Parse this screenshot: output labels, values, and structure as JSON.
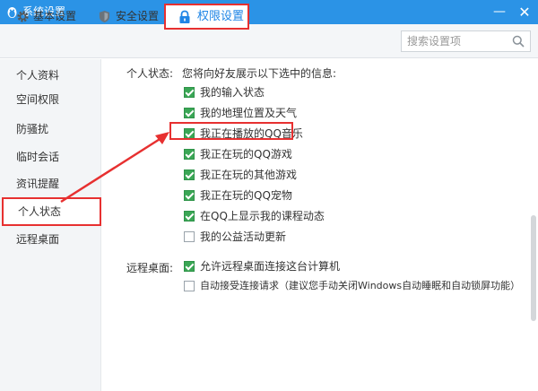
{
  "window": {
    "title": "系统设置",
    "minimize_glyph": "—",
    "close_glyph": "✕",
    "logo_icon": "qq-penguin-icon"
  },
  "toolbar": {
    "tabs": [
      {
        "label": "基本设置",
        "icon": "gear-icon"
      },
      {
        "label": "安全设置",
        "icon": "shield-icon"
      },
      {
        "label": "权限设置",
        "icon": "lock-icon",
        "active": true
      }
    ]
  },
  "search": {
    "placeholder": "搜索设置项",
    "icon": "search-icon"
  },
  "sidebar": {
    "items": [
      {
        "label": "个人资料"
      },
      {
        "label": "空间权限"
      },
      {
        "label": "防骚扰"
      },
      {
        "label": "临时会话"
      },
      {
        "label": "资讯提醒"
      },
      {
        "label": "个人状态",
        "active": true
      },
      {
        "label": "远程桌面"
      }
    ]
  },
  "personal_status": {
    "label": "个人状态:",
    "intro": "您将向好友展示以下选中的信息:",
    "options": [
      {
        "label": "我的输入状态",
        "checked": true
      },
      {
        "label": "我的地理位置及天气",
        "checked": true
      },
      {
        "label": "我正在播放的QQ音乐",
        "checked": true
      },
      {
        "label": "我正在玩的QQ游戏",
        "checked": true
      },
      {
        "label": "我正在玩的其他游戏",
        "checked": true
      },
      {
        "label": "我正在玩的QQ宠物",
        "checked": true
      },
      {
        "label": "在QQ上显示我的课程动态",
        "checked": true
      },
      {
        "label": "我的公益活动更新",
        "checked": false
      }
    ]
  },
  "remote_desktop": {
    "label": "远程桌面:",
    "options": [
      {
        "label": "允许远程桌面连接这台计算机",
        "checked": true
      },
      {
        "label": "自动接受连接请求（建议您手动关闭Windows自动睡眠和自动锁屏功能）",
        "checked": false
      }
    ]
  },
  "colors": {
    "titlebar": "#2b93e6",
    "highlight_red": "#e73030",
    "checkbox_green": "#3aa655",
    "active_tab_text": "#1f85e6"
  }
}
